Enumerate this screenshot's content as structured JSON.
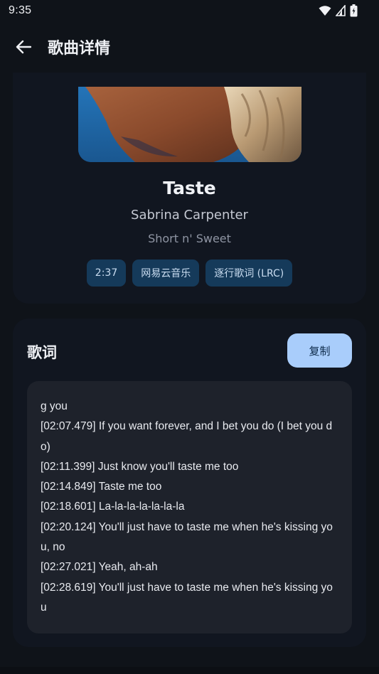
{
  "status_bar": {
    "time": "9:35",
    "icons": [
      "wifi-icon",
      "signal-icon",
      "battery-icon"
    ]
  },
  "app_bar": {
    "back_icon": "arrow-left-icon",
    "title": "歌曲详情"
  },
  "song": {
    "title": "Taste",
    "artist": "Sabrina Carpenter",
    "album": "Short n' Sweet",
    "chips": [
      {
        "label": "2:37"
      },
      {
        "label": "网易云音乐"
      },
      {
        "label": "逐行歌词 (LRC)"
      }
    ]
  },
  "lyrics": {
    "heading": "歌词",
    "copy_label": "复制",
    "lines": [
      "g you",
      "[02:07.479] If you want forever, and I bet you do (I bet you do)",
      "[02:11.399] Just know you'll taste me too",
      "[02:14.849] Taste me too",
      "[02:18.601] La-la-la-la-la-la-la",
      "[02:20.124] You'll just have to taste me when he's kissing you, no",
      "[02:27.021] Yeah, ah-ah",
      "[02:28.619] You'll just have to taste me when he's kissing you"
    ]
  },
  "colors": {
    "background": "#0f1319",
    "card": "#111620",
    "lyrics_box": "#1e222b",
    "chip_bg": "#153a5a",
    "copy_button": "#a9cdfb"
  }
}
